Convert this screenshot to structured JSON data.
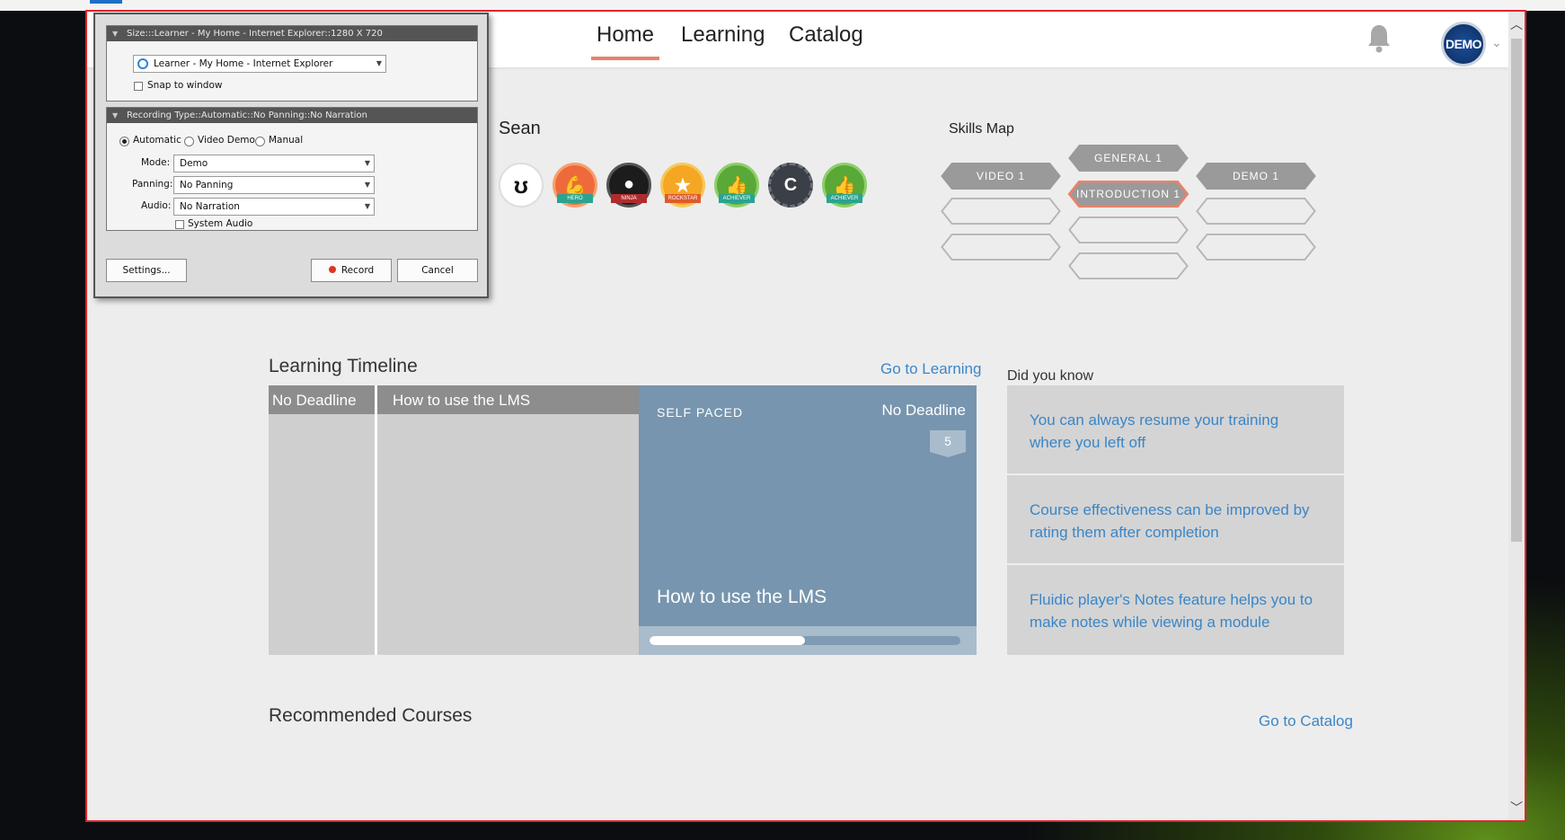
{
  "header": {
    "tabs": [
      {
        "label": "Home",
        "active": true
      },
      {
        "label": "Learning",
        "active": false
      },
      {
        "label": "Catalog",
        "active": false
      }
    ],
    "avatar_text": "DEMO",
    "icons": {
      "notifications": "bell-icon",
      "menu": "chevron-down-icon"
    }
  },
  "profile": {
    "name": "Sean",
    "badges": [
      {
        "ribbon": "",
        "color": "#ffffff",
        "glyph": "ʊ"
      },
      {
        "ribbon": "HERO",
        "color": "#ef6a3a",
        "glyph": "💪"
      },
      {
        "ribbon": "NINJA",
        "color": "#1c1c1c",
        "glyph": "●"
      },
      {
        "ribbon": "ROCKSTAR",
        "color": "#f5a623",
        "glyph": "★"
      },
      {
        "ribbon": "ACHIEVER",
        "color": "#5aa837",
        "glyph": "👍"
      },
      {
        "ribbon": "",
        "color": "#3b3f47",
        "glyph": "C"
      },
      {
        "ribbon": "ACHIEVER",
        "color": "#5aa837",
        "glyph": "👍"
      }
    ]
  },
  "skills_map": {
    "title": "Skills Map",
    "skills": [
      {
        "label": "VIDEO 1",
        "highlight": false
      },
      {
        "label": "GENERAL 1",
        "highlight": false
      },
      {
        "label": "INTRODUCTION 1",
        "highlight": true
      },
      {
        "label": "DEMO 1",
        "highlight": false
      }
    ]
  },
  "timeline": {
    "title": "Learning Timeline",
    "link": "Go to Learning",
    "header": {
      "deadline": "No Deadline",
      "course": "How to use the LMS"
    },
    "card": {
      "type": "SELF PACED",
      "deadline": "No Deadline",
      "count": "5",
      "title": "How to use the LMS",
      "progress": 0.5
    }
  },
  "did_you_know": {
    "title": "Did you know",
    "items": [
      "You can always resume your training where you left off",
      "Course effectiveness can be improved by rating them after completion",
      "Fluidic player's Notes feature helps you to make notes while viewing a module"
    ]
  },
  "recommended": {
    "title": "Recommended Courses",
    "link": "Go to Catalog"
  },
  "recorder": {
    "size_bar": "Size:::Learner - My Home - Internet Explorer::1280 X 720",
    "window_select": "Learner - My Home - Internet Explorer",
    "snap_label": "Snap to window",
    "recording_bar": "Recording Type::Automatic::No Panning::No Narration",
    "modes": [
      {
        "label": "Automatic",
        "selected": true
      },
      {
        "label": "Video Demo",
        "selected": false
      },
      {
        "label": "Manual",
        "selected": false
      }
    ],
    "mode_label": "Mode:",
    "mode_value": "Demo",
    "panning_label": "Panning:",
    "panning_value": "No Panning",
    "audio_label": "Audio:",
    "audio_value": "No Narration",
    "system_audio_label": "System Audio",
    "settings_button": "Settings...",
    "record_button": "Record",
    "cancel_button": "Cancel"
  }
}
